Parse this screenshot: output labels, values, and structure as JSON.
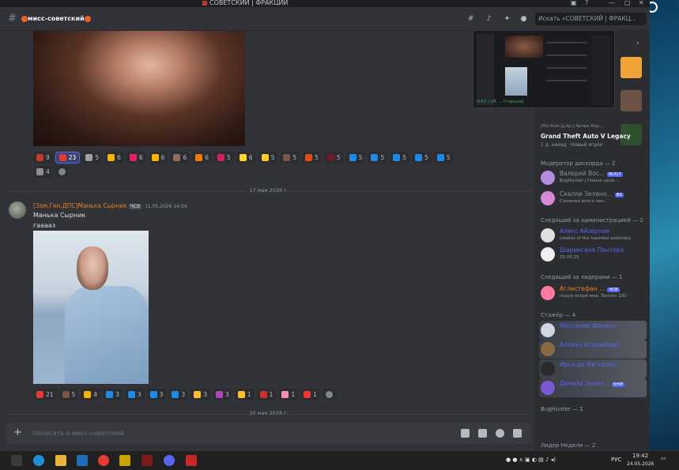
{
  "window": {
    "title": "СОВЕТСКИЙ | ФРАКЦИИ"
  },
  "header": {
    "channel_name": "мисс-советский",
    "search_placeholder": "Искать «СОВЕТСКИЙ | ФРАКЦ..."
  },
  "messages": {
    "reactions_1": [
      {
        "icon": "lips-emoji",
        "count": "9"
      },
      {
        "icon": "heart-emoji",
        "count": "23",
        "selected": true
      },
      {
        "icon": "note-emoji",
        "count": "5"
      },
      {
        "icon": "smirk-emoji",
        "count": "6"
      },
      {
        "icon": "heart-pink-emoji",
        "count": "6"
      },
      {
        "icon": "heart-eyes-emoji",
        "count": "6"
      },
      {
        "icon": "cat-emoji",
        "count": "6"
      },
      {
        "icon": "fire-emoji",
        "count": "6"
      },
      {
        "icon": "hearts-emoji",
        "count": "5"
      },
      {
        "icon": "pikachu-emoji",
        "count": "6"
      },
      {
        "icon": "cat-yellow-emoji",
        "count": "5"
      },
      {
        "icon": "photo-emoji",
        "count": "5"
      },
      {
        "icon": "mushroom-emoji",
        "count": "5"
      },
      {
        "icon": "dark-heart-emoji",
        "count": "5"
      },
      {
        "icon": "letter-s",
        "count": "5"
      },
      {
        "icon": "letter-o",
        "count": "5"
      },
      {
        "icon": "letter-t",
        "count": "5"
      },
      {
        "icon": "letter-k",
        "count": "5"
      },
      {
        "icon": "letter-a",
        "count": "5"
      }
    ],
    "reactions_1b": [
      {
        "icon": "sticker-emoji",
        "count": "4"
      }
    ],
    "date_1": "17 мая 2026 г.",
    "author": "[Зам.Ген.ДПС]Манька Сырник",
    "author_tag": "ЧСВ",
    "timestamp": "11.05.2026 14:54",
    "line_1": "Манька Сырник",
    "line_2": "гааааз",
    "reactions_2": [
      {
        "icon": "heart-emoji",
        "count": "21"
      },
      {
        "icon": "photo-emoji",
        "count": "5"
      },
      {
        "icon": "smirk-emoji",
        "count": "4"
      },
      {
        "icon": "letter-m",
        "count": "3"
      },
      {
        "icon": "letter-o",
        "count": "3"
      },
      {
        "icon": "letter-r",
        "count": "3"
      },
      {
        "icon": "letter-g",
        "count": "3"
      },
      {
        "icon": "bird-emoji",
        "count": "3"
      },
      {
        "icon": "gem-emoji",
        "count": "3"
      },
      {
        "icon": "speech-emoji",
        "count": "1"
      },
      {
        "icon": "cross-emoji",
        "count": "1"
      },
      {
        "icon": "pig-emoji",
        "count": "1"
      },
      {
        "icon": "red-circle-emoji",
        "count": "1"
      }
    ],
    "date_2": "20 мая 2026 г."
  },
  "composer": {
    "placeholder": "Написать в мисс-советский"
  },
  "members": {
    "stream_time": "4:47 | 28 ... Старший",
    "game_user": "[Мл.Ком.Ц.Ар.] Арчик Кир...",
    "game_title": "Grand Theft Auto V Legacy",
    "game_status": "1 д. назад · Новый игрок",
    "sections": [
      {
        "title": "Модератор дискорда — 2",
        "items": [
          {
            "name": "Валерий Вос...",
            "badge": "BUG7",
            "status": "BugHunter | Новые цели ...",
            "color": "#8b8e96"
          },
          {
            "name": "Скалли Зелено...",
            "badge": "ВII",
            "status": "Сложнее всего нач...",
            "color": "#8b8e96"
          }
        ]
      },
      {
        "title": "Следящий за администрацией — 2",
        "items": [
          {
            "name": "Алекс Айзерная",
            "badge": "",
            "status": "creator of the haunted assembly.",
            "color": "#5865f2"
          },
          {
            "name": "Шарингана Пантера",
            "badge": "",
            "status": "25.05.25",
            "color": "#5865f2"
          }
        ]
      },
      {
        "title": "Следящий за лидерами — 1",
        "items": [
          {
            "name": "Аглистефан ...",
            "badge": "ЧСВ",
            "status": "похуй похуй мне, Toronto 100",
            "color": "#e67e22"
          }
        ]
      },
      {
        "title": "Стажёр — 4",
        "items": [
          {
            "name": "Массяний Фокаро",
            "badge": "",
            "status": "",
            "color": "#5865f2"
          },
          {
            "name": "Аллеко Агравебаус",
            "badge": "",
            "status": "",
            "color": "#5865f2"
          },
          {
            "name": "Ирка де Фетирхоу",
            "badge": "",
            "status": "",
            "color": "#5865f2"
          },
          {
            "name": "Данила Зелен...",
            "badge": "SHIP",
            "status": "",
            "color": "#5865f2"
          }
        ]
      },
      {
        "title": "BugHunter — 1",
        "items": []
      },
      {
        "title": "Лидер Недели — 2",
        "items": []
      }
    ]
  },
  "taskbar": {
    "lang": "РУС",
    "time": "19:42",
    "date": "24.05.2026"
  },
  "colors": {
    "accent": "#5865f2",
    "bg": "#313338",
    "sidebar": "#2b2d31",
    "author": "#e67e22"
  }
}
